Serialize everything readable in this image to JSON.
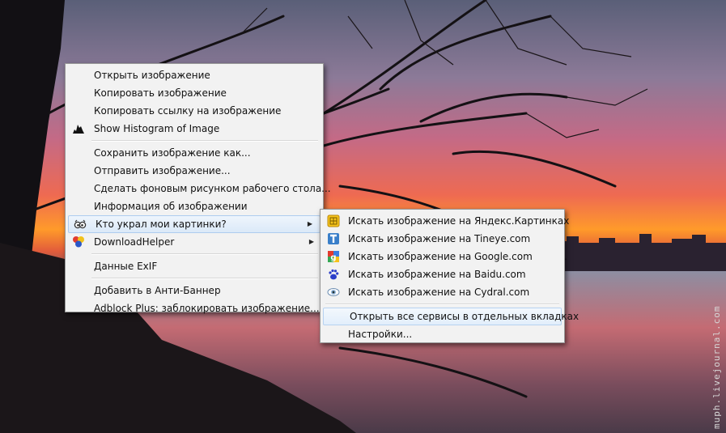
{
  "main_menu": {
    "items": [
      {
        "label": "Открыть изображение"
      },
      {
        "label": "Копировать изображение"
      },
      {
        "label": "Копировать ссылку на изображение"
      },
      {
        "label": "Show Histogram of Image",
        "icon": "histogram-icon"
      },
      {
        "label": "Сохранить изображение как..."
      },
      {
        "label": "Отправить изображение..."
      },
      {
        "label": "Сделать фоновым рисунком рабочего стола..."
      },
      {
        "label": "Информация об изображении"
      },
      {
        "label": "Кто украл мои картинки?",
        "icon": "owl-icon"
      },
      {
        "label": "DownloadHelper",
        "icon": "downloadhelper-icon"
      },
      {
        "label": "Данные ExIF"
      },
      {
        "label": "Добавить в Анти-Баннер"
      },
      {
        "label": "Adblock Plus: заблокировать изображение..."
      }
    ]
  },
  "sub_menu": {
    "items": [
      {
        "label": "Искать изображение на Яндекс.Картинках",
        "icon": "yandex-icon"
      },
      {
        "label": "Искать изображение на Tineye.com",
        "icon": "tineye-icon"
      },
      {
        "label": "Искать изображение на Google.com",
        "icon": "google-icon"
      },
      {
        "label": "Искать изображение на Baidu.com",
        "icon": "baidu-icon"
      },
      {
        "label": "Искать изображение на Cydral.com",
        "icon": "cydral-icon"
      },
      {
        "label": "Открыть все сервисы в отдельных вкладках"
      },
      {
        "label": "Настройки..."
      }
    ]
  },
  "watermark": "muph.livejournal.com",
  "colors": {
    "menu_bg": "#f2f2f2",
    "highlight": "#dbe9f8",
    "highlight_border": "#aeccef"
  }
}
